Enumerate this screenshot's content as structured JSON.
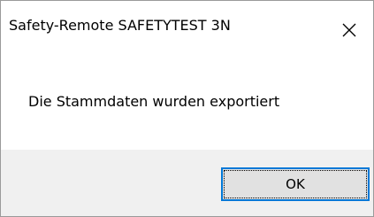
{
  "window": {
    "title": "Safety-Remote SAFETYTEST 3N",
    "close_icon": "close-icon"
  },
  "message": {
    "text": "Die Stammdaten wurden exportiert"
  },
  "buttons": {
    "ok_label": "OK"
  },
  "colors": {
    "background": "#ffffff",
    "button_bar": "#f0f0f0",
    "button_face": "#e1e1e1",
    "focus_border": "#0078d7"
  }
}
